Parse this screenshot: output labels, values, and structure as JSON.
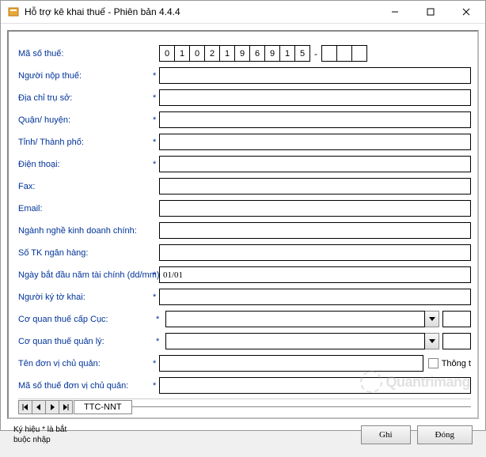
{
  "window": {
    "title": "Hỗ trợ kê khai thuế -  Phiên bản 4.4.4"
  },
  "form": {
    "taxCode": {
      "label": "Mã số thuế:",
      "digits": [
        "0",
        "1",
        "0",
        "2",
        "1",
        "9",
        "6",
        "9",
        "1",
        "5"
      ],
      "ext": [
        "",
        "",
        ""
      ]
    },
    "taxpayer": {
      "label": "Người nộp thuế:",
      "required": "*",
      "value": ""
    },
    "address": {
      "label": "Địa chỉ trụ sở:",
      "required": "*",
      "value": ""
    },
    "district": {
      "label": "Quận/ huyện:",
      "required": "*",
      "value": ""
    },
    "province": {
      "label": "Tỉnh/ Thành phố:",
      "required": "*",
      "value": ""
    },
    "phone": {
      "label": "Điện thoại:",
      "required": "*",
      "value": ""
    },
    "fax": {
      "label": "Fax:",
      "required": "",
      "value": ""
    },
    "email": {
      "label": "Email:",
      "required": "",
      "value": ""
    },
    "business": {
      "label": "Ngành nghề kinh doanh chính:",
      "required": "",
      "value": ""
    },
    "bankAcct": {
      "label": "Số TK ngân hàng:",
      "required": "",
      "value": ""
    },
    "fiscalStart": {
      "label": "Ngày bắt đầu năm tài chính (dd/mm):",
      "required": "*",
      "value": "01/01"
    },
    "signer": {
      "label": "Người ký tờ khai:",
      "required": "*",
      "value": ""
    },
    "taxDept": {
      "label": "Cơ quan thuế cấp Cục:",
      "required": "*",
      "value": ""
    },
    "taxMgmt": {
      "label": "Cơ quan thuế quản lý:",
      "required": "*",
      "value": ""
    },
    "parentOrg": {
      "label": "Tên đơn vị chủ quản:",
      "required": "*",
      "value": "",
      "checkboxLabel": "Thông t"
    },
    "parentTaxCode": {
      "label": "Mã số thuế đơn vị chủ quản:",
      "required": "*",
      "value": ""
    }
  },
  "tabs": {
    "active": "TTC-NNT"
  },
  "footer": {
    "note": "Ký hiệu * là bắt\nbuộc nhập",
    "save": "Ghi",
    "close": "Đóng"
  },
  "watermark": "Quantrimang"
}
